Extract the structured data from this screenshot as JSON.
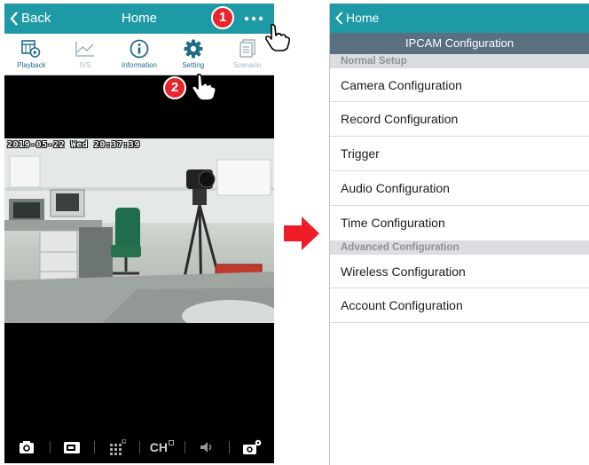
{
  "left": {
    "back_label": "Back",
    "title": "Home",
    "toolbar": [
      {
        "label": "Playback",
        "icon": "playback-icon"
      },
      {
        "label": "IVS",
        "icon": "ivs-chart-icon"
      },
      {
        "label": "Information",
        "icon": "info-icon"
      },
      {
        "label": "Setting",
        "icon": "gear-icon"
      },
      {
        "label": "Scenario",
        "icon": "scenario-icon"
      }
    ],
    "osd_text": "2019-05-22 Wed 20:37:39",
    "bottom_bar": {
      "ch_label": "CH"
    },
    "badges": {
      "one": "1",
      "two": "2"
    }
  },
  "right": {
    "back_label": "Home",
    "title": "IPCAM Configuration",
    "sections": [
      {
        "header": "Normal Setup",
        "items": [
          "Camera Configuration",
          "Record Configuration",
          "Trigger",
          "Audio Configuration",
          "Time Configuration"
        ]
      },
      {
        "header": "Advanced Configuration",
        "items": [
          "Wireless Configuration",
          "Account Configuration"
        ]
      }
    ]
  },
  "colors": {
    "nav": "#1e9aa6",
    "title_bar": "#5a6f80",
    "badge": "#e8242c",
    "arrow": "#ee1c24"
  }
}
